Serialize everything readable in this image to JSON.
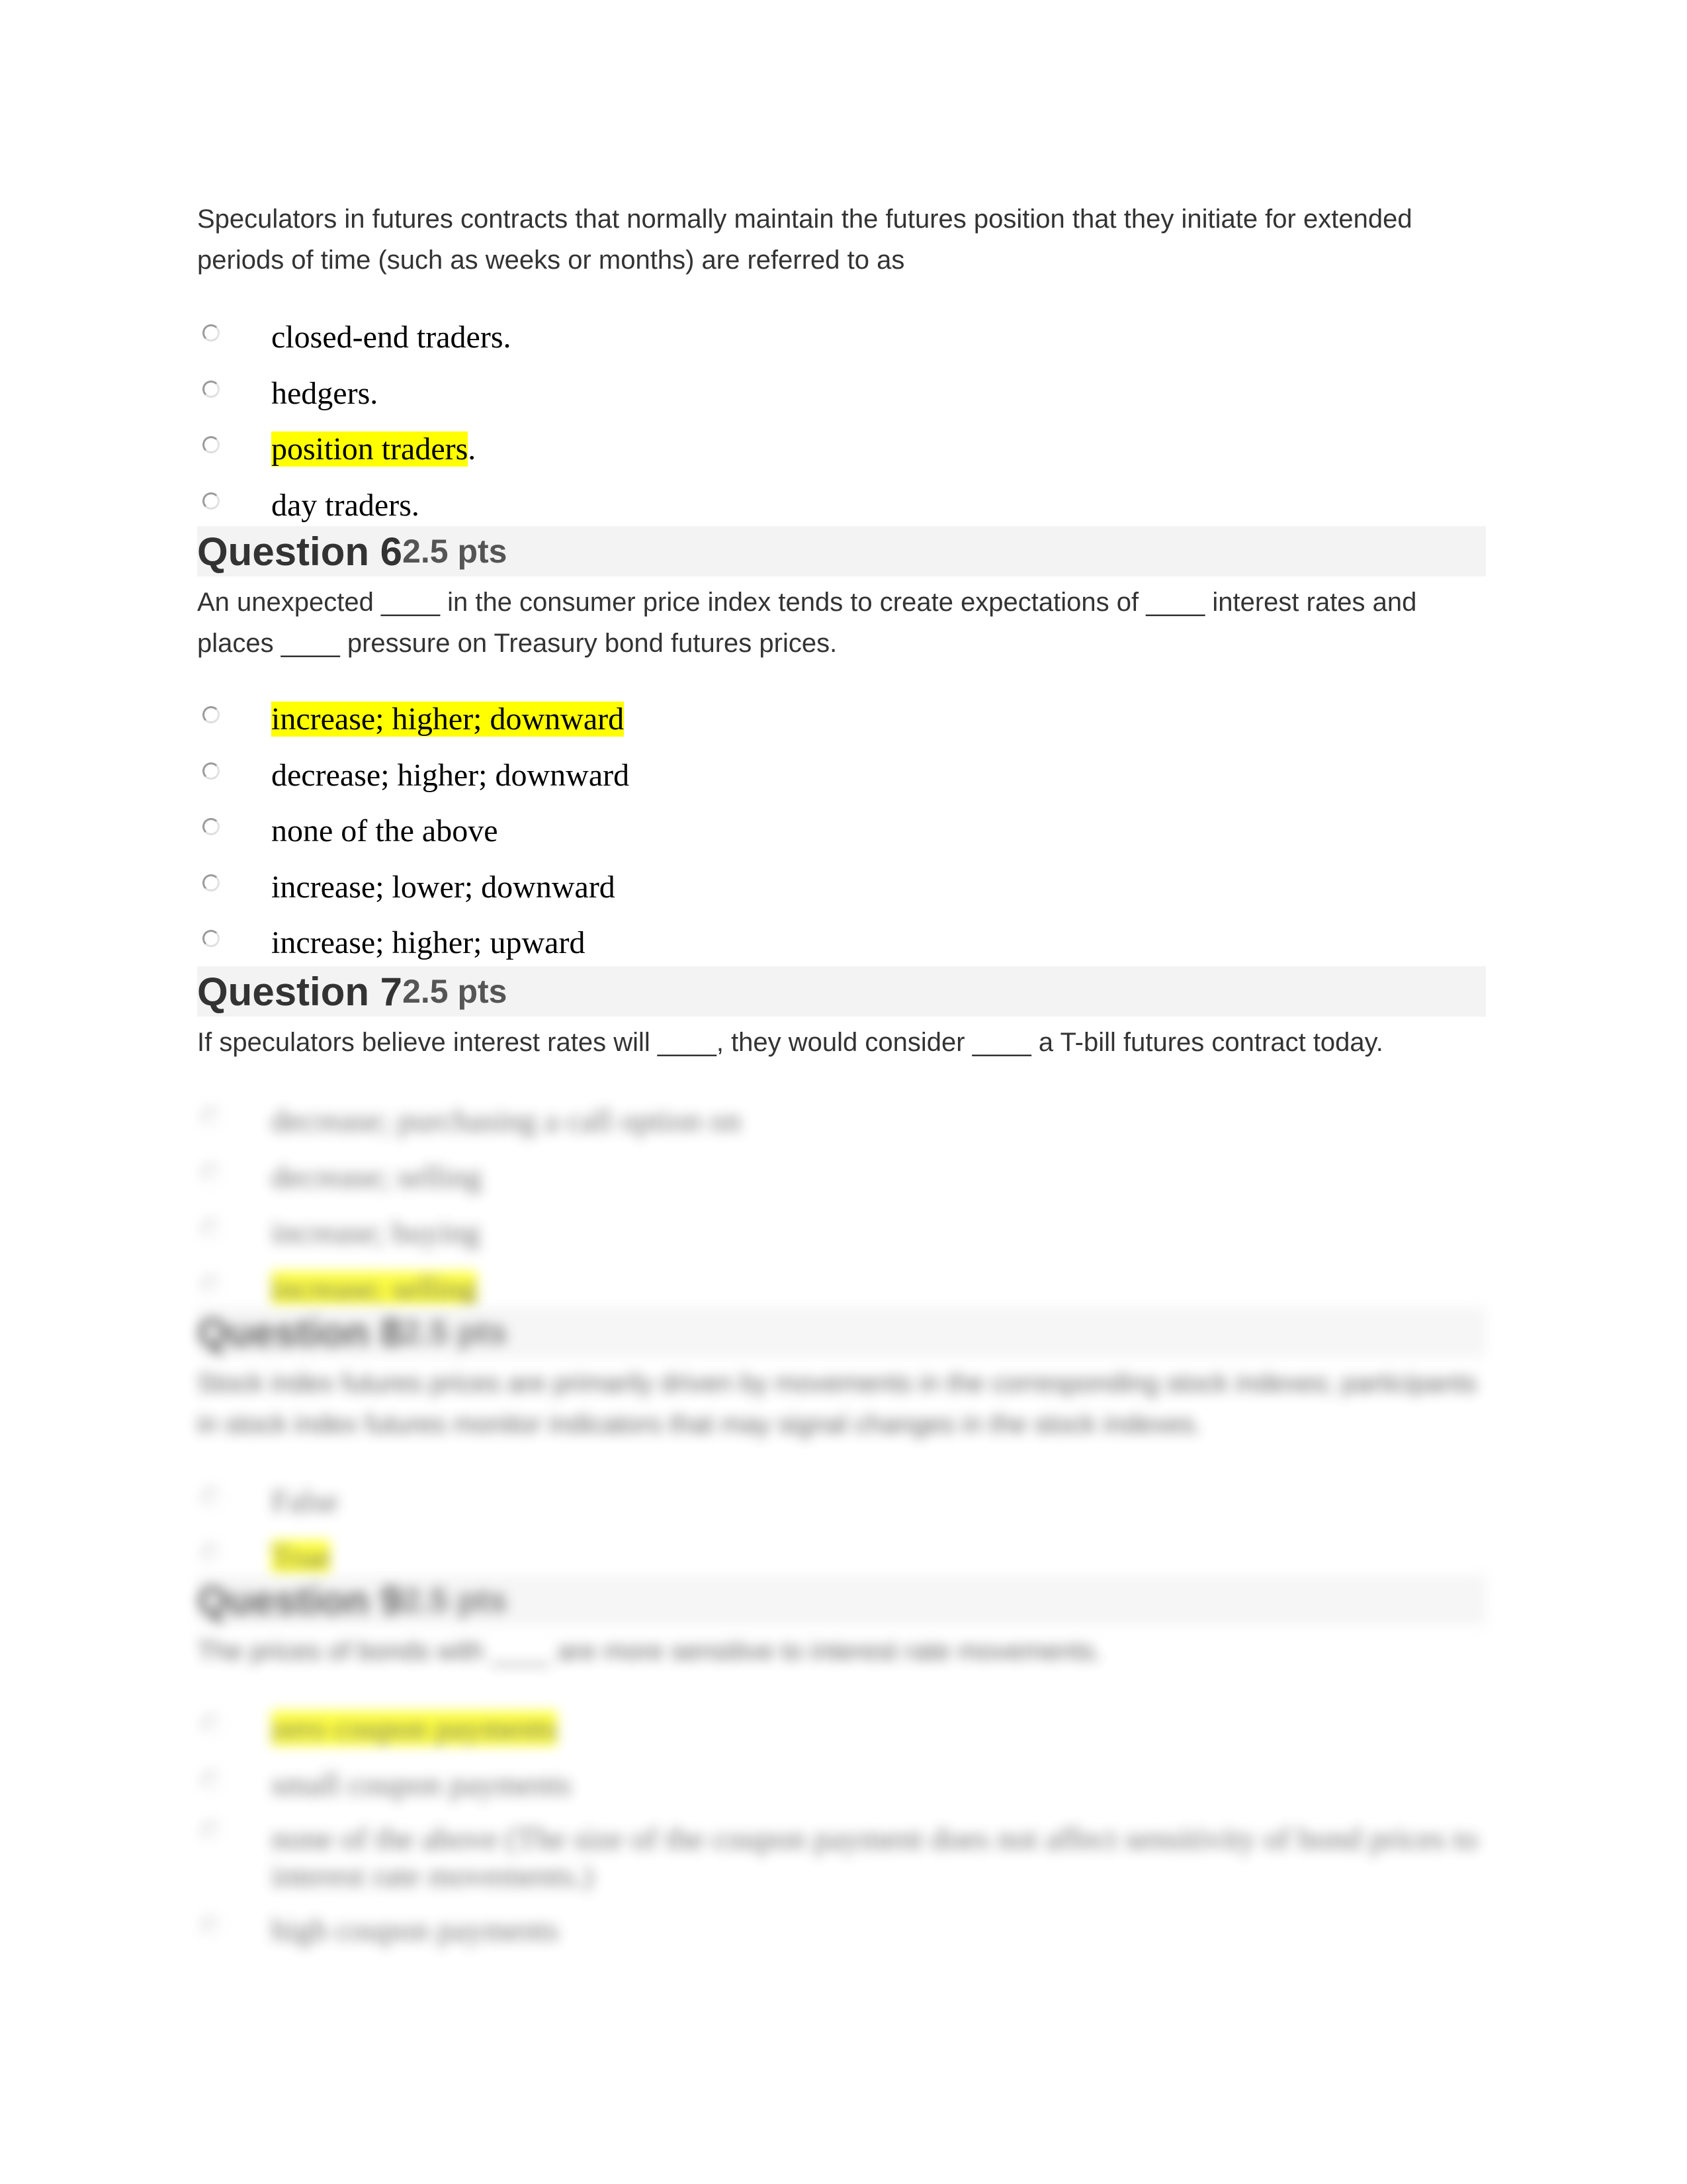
{
  "questions": [
    {
      "number": "",
      "points": "",
      "text": "Speculators in futures contracts that normally maintain the futures position that they initiate for extended periods of time (such as weeks or months) are referred to as",
      "options": [
        {
          "label": "closed-end traders.",
          "highlighted_part": "",
          "rest": "closed-end traders."
        },
        {
          "label": "hedgers.",
          "highlighted_part": "",
          "rest": "hedgers."
        },
        {
          "label": "position traders.",
          "highlighted_part": "position traders",
          "rest": "."
        },
        {
          "label": "day traders.",
          "highlighted_part": "",
          "rest": "day traders."
        }
      ],
      "blurred": false
    },
    {
      "number": "Question 6",
      "points": "2.5 pts",
      "text": "An unexpected ____ in the consumer price index tends to create expectations of ____ interest rates and places ____ pressure on Treasury bond futures prices.",
      "options": [
        {
          "label": "increase; higher; downward",
          "highlighted_part": "increase; higher; downward",
          "rest": ""
        },
        {
          "label": "decrease; higher; downward",
          "highlighted_part": "",
          "rest": "decrease; higher; downward"
        },
        {
          "label": "none of the above",
          "highlighted_part": "",
          "rest": "none of the above"
        },
        {
          "label": "increase; lower; downward",
          "highlighted_part": "",
          "rest": "increase; lower; downward"
        },
        {
          "label": "increase; higher; upward",
          "highlighted_part": "",
          "rest": "increase; higher; upward"
        }
      ],
      "blurred": false
    },
    {
      "number": "Question 7",
      "points": "2.5 pts",
      "text": "If speculators believe interest rates will ____, they would consider ____ a T-bill futures contract today.",
      "options": [
        {
          "label": "decrease; purchasing a call option on",
          "highlighted_part": "",
          "rest": "decrease; purchasing a call option on"
        },
        {
          "label": "decrease; selling",
          "highlighted_part": "",
          "rest": "decrease; selling"
        },
        {
          "label": "increase; buying",
          "highlighted_part": "",
          "rest": "increase; buying"
        },
        {
          "label": "increase; selling",
          "highlighted_part": "increase; selling",
          "rest": ""
        }
      ],
      "options_blurred": true
    },
    {
      "number": "Question 8",
      "points": "2.5 pts",
      "text": "Stock index futures prices are primarily driven by movements in the corresponding stock indexes; participants in stock index futures monitor indicators that may signal changes in the stock indexes.",
      "options": [
        {
          "label": "False",
          "highlighted_part": "",
          "rest": "False"
        },
        {
          "label": "True",
          "highlighted_part": "True",
          "rest": ""
        }
      ],
      "blurred": true
    },
    {
      "number": "Question 9",
      "points": "2.5 pts",
      "text": "The prices of bonds with ____ are more sensitive to interest rate movements.",
      "options": [
        {
          "label": "zero coupon payments",
          "highlighted_part": "zero coupon payments",
          "rest": ""
        },
        {
          "label": "small coupon payments",
          "highlighted_part": "",
          "rest": "small coupon payments"
        },
        {
          "label": "none of the above (The size of the coupon payment does not affect sensitivity of bond prices to interest rate movements.)",
          "highlighted_part": "",
          "rest": "none of the above (The size of the coupon payment does not affect sensitivity of bond prices to interest rate movements.)"
        },
        {
          "label": "high coupon payments",
          "highlighted_part": "",
          "rest": "high coupon payments"
        }
      ],
      "blurred": true
    }
  ],
  "colors": {
    "highlight": "#ffff00",
    "header_bg": "#f3f3f3",
    "body_text": "#333333",
    "option_text": "#000000"
  }
}
